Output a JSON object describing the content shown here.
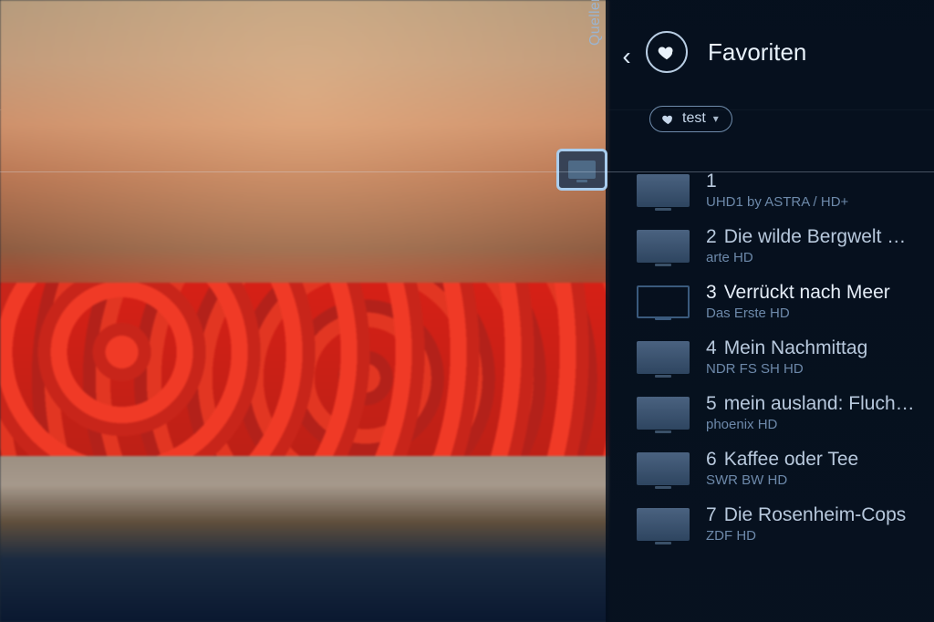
{
  "sidebar": {
    "tab_label": "Quellen"
  },
  "header": {
    "title": "Favoriten"
  },
  "filter": {
    "label": "test"
  },
  "channels": [
    {
      "num": "1",
      "title": "",
      "sub": "UHD1 by ASTRA / HD+",
      "selected": false
    },
    {
      "num": "2",
      "title": "Die wilde Bergwelt …",
      "sub": "arte HD",
      "selected": false
    },
    {
      "num": "3",
      "title": "Verrückt nach Meer",
      "sub": "Das Erste HD",
      "selected": true
    },
    {
      "num": "4",
      "title": "Mein Nachmittag",
      "sub": "NDR FS SH HD",
      "selected": false
    },
    {
      "num": "5",
      "title": "mein ausland: Fluch…",
      "sub": "phoenix HD",
      "selected": false
    },
    {
      "num": "6",
      "title": "Kaffee oder Tee",
      "sub": "SWR BW HD",
      "selected": false
    },
    {
      "num": "7",
      "title": "Die Rosenheim-Cops",
      "sub": "ZDF HD",
      "selected": false
    }
  ]
}
